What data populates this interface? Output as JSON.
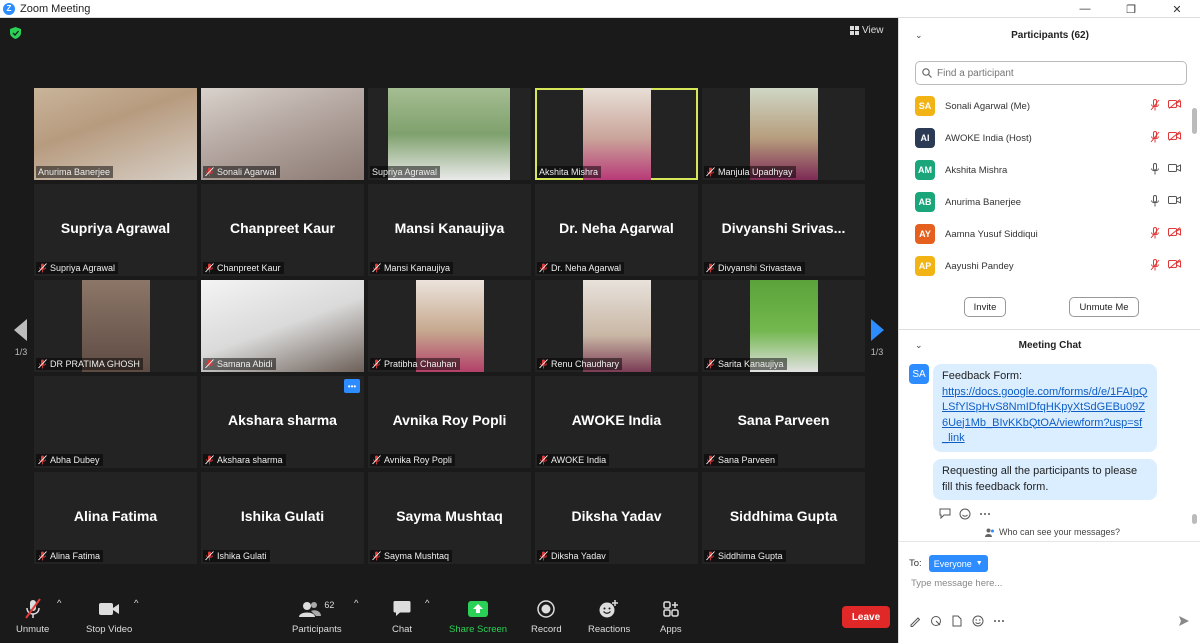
{
  "window": {
    "title": "Zoom Meeting",
    "minimize": "—",
    "maximize": "❐",
    "close": "✕"
  },
  "meeting": {
    "view_label": "View",
    "page_left": "1/3",
    "page_right": "1/3",
    "tiles": [
      {
        "name": "Anurima Banerjee",
        "video": true,
        "muted": false
      },
      {
        "name": "Sonali Agarwal",
        "video": true,
        "muted": true
      },
      {
        "name": "Supriya Agrawal",
        "video": true,
        "muted": false
      },
      {
        "name": "Akshita Mishra",
        "video": true,
        "muted": false,
        "active": true
      },
      {
        "name": "Manjula Upadhyay",
        "video": true,
        "muted": true
      },
      {
        "name": "Supriya Agrawal",
        "display": "Supriya Agrawal",
        "video": false,
        "muted": true
      },
      {
        "name": "Chanpreet Kaur",
        "display": "Chanpreet Kaur",
        "video": false,
        "muted": true
      },
      {
        "name": "Mansi Kanaujiya",
        "display": "Mansi Kanaujiya",
        "video": false,
        "muted": true
      },
      {
        "name": "Dr. Neha Agarwal",
        "display": "Dr. Neha Agarwal",
        "video": false,
        "muted": true
      },
      {
        "name": "Divyanshi Srivastava",
        "display": "Divyanshi  Srivas...",
        "video": false,
        "muted": true
      },
      {
        "name": "DR PRATIMA GHOSH",
        "video": true,
        "muted": true
      },
      {
        "name": "Samana Abidi",
        "video": true,
        "muted": true
      },
      {
        "name": "Pratibha Chauhan",
        "video": true,
        "muted": true
      },
      {
        "name": "Renu Chaudhary",
        "video": true,
        "muted": true
      },
      {
        "name": "Sarita Kanaujiya",
        "video": true,
        "muted": true
      },
      {
        "name": "Abha Dubey",
        "display": "",
        "video": false,
        "muted": true
      },
      {
        "name": "Akshara sharma",
        "display": "Akshara sharma",
        "video": false,
        "muted": true,
        "more": true
      },
      {
        "name": "Avnika Roy Popli",
        "display": "Avnika Roy Popli",
        "video": false,
        "muted": true
      },
      {
        "name": "AWOKE India",
        "display": "AWOKE India",
        "video": false,
        "muted": true
      },
      {
        "name": "Sana Parveen",
        "display": "Sana Parveen",
        "video": false,
        "muted": true
      },
      {
        "name": "Alina Fatima",
        "display": "Alina Fatima",
        "video": false,
        "muted": true
      },
      {
        "name": "Ishika Gulati",
        "display": "Ishika Gulati",
        "video": false,
        "muted": true
      },
      {
        "name": "Sayma Mushtaq",
        "display": "Sayma Mushtaq",
        "video": false,
        "muted": true
      },
      {
        "name": "Diksha Yadav",
        "display": "Diksha Yadav",
        "video": false,
        "muted": true
      },
      {
        "name": "Siddhima Gupta",
        "display": "Siddhima Gupta",
        "video": false,
        "muted": true
      }
    ]
  },
  "toolbar": {
    "unmute": "Unmute",
    "stop_video": "Stop Video",
    "participants": "Participants",
    "participants_count": "62",
    "chat": "Chat",
    "share_screen": "Share Screen",
    "record": "Record",
    "reactions": "Reactions",
    "apps": "Apps",
    "leave": "Leave"
  },
  "participants": {
    "title": "Participants (62)",
    "search_placeholder": "Find a participant",
    "items": [
      {
        "initials": "SA",
        "name": "Sonali Agarwal (Me)",
        "color": "#f2b315",
        "mic_muted": true,
        "video_off": true
      },
      {
        "initials": "AI",
        "name": "AWOKE India (Host)",
        "color": "#2b3a55",
        "mic_muted": true,
        "video_off": true
      },
      {
        "initials": "AM",
        "name": "Akshita Mishra",
        "color": "#1aa57a",
        "mic_muted": false,
        "video_off": false
      },
      {
        "initials": "AB",
        "name": "Anurima Banerjee",
        "color": "#1aa57a",
        "mic_muted": false,
        "video_off": false
      },
      {
        "initials": "AY",
        "name": "Aamna Yusuf Siddiqui",
        "color": "#e5601e",
        "mic_muted": true,
        "video_off": true
      },
      {
        "initials": "AP",
        "name": "Aayushi Pandey",
        "color": "#f2b315",
        "mic_muted": true,
        "video_off": true
      }
    ],
    "invite": "Invite",
    "unmute_me": "Unmute Me"
  },
  "chat": {
    "title": "Meeting Chat",
    "sender_initials": "SA",
    "msg1_prefix": "Feedback Form:",
    "msg1_link": "https://docs.google.com/forms/d/e/1FAIpQLSfYlSpHvS8NmIDfqHKpyXtSdGEBu09Z6Uej1Mb_BIvKKbQtOA/viewform?usp=sf_link",
    "msg2": "Requesting all the participants to please fill this feedback form.",
    "who_can_see": "Who can see your messages?",
    "to_label": "To:",
    "to_value": "Everyone",
    "input_placeholder": "Type message here..."
  },
  "colors": {
    "accent": "#2d8cff",
    "leave": "#e02828",
    "share": "#2bd157",
    "active_speaker": "#d6e85a",
    "muted_red": "#e03a3a"
  }
}
